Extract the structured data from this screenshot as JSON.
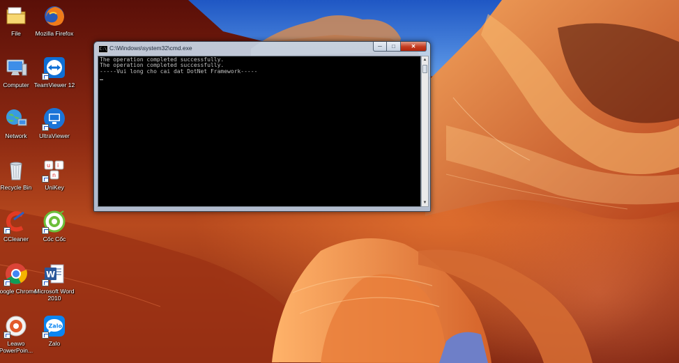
{
  "desktop": {
    "icons": [
      {
        "label": "File",
        "icon": "folder-icon"
      },
      {
        "label": "Mozilla Firefox",
        "icon": "firefox-icon"
      },
      {
        "label": "Computer",
        "icon": "computer-icon"
      },
      {
        "label": "TeamViewer 12",
        "icon": "teamviewer-icon"
      },
      {
        "label": "Network",
        "icon": "network-icon"
      },
      {
        "label": "UltraViewer",
        "icon": "ultraviewer-icon"
      },
      {
        "label": "Recycle Bin",
        "icon": "recycle-bin-icon"
      },
      {
        "label": "UniKey",
        "icon": "unikey-icon"
      },
      {
        "label": "CCleaner",
        "icon": "ccleaner-icon"
      },
      {
        "label": "Cốc Cốc",
        "icon": "coccoc-icon"
      },
      {
        "label": "Google Chrome",
        "icon": "chrome-icon"
      },
      {
        "label": "Microsoft Word 2010",
        "icon": "word-icon"
      },
      {
        "label": "Leawo PowerPoin...",
        "icon": "leawo-icon"
      },
      {
        "label": "Zalo",
        "icon": "zalo-icon"
      }
    ]
  },
  "cmd_window": {
    "title": "C:\\Windows\\system32\\cmd.exe",
    "app_icon_text": "C:\\",
    "buttons": {
      "minimize": "─",
      "maximize": "□",
      "close": "✕"
    },
    "console_text": "The operation completed successfully.\nThe operation completed successfully.\n-----Vui long cho cai dat DotNet Framework-----",
    "scroll": {
      "up": "▲",
      "down": "▼"
    }
  },
  "colors": {
    "console_bg": "#000000",
    "console_text": "#c0c0c0",
    "close_button": "#c43a1e",
    "sky": "#2d6fd6"
  }
}
